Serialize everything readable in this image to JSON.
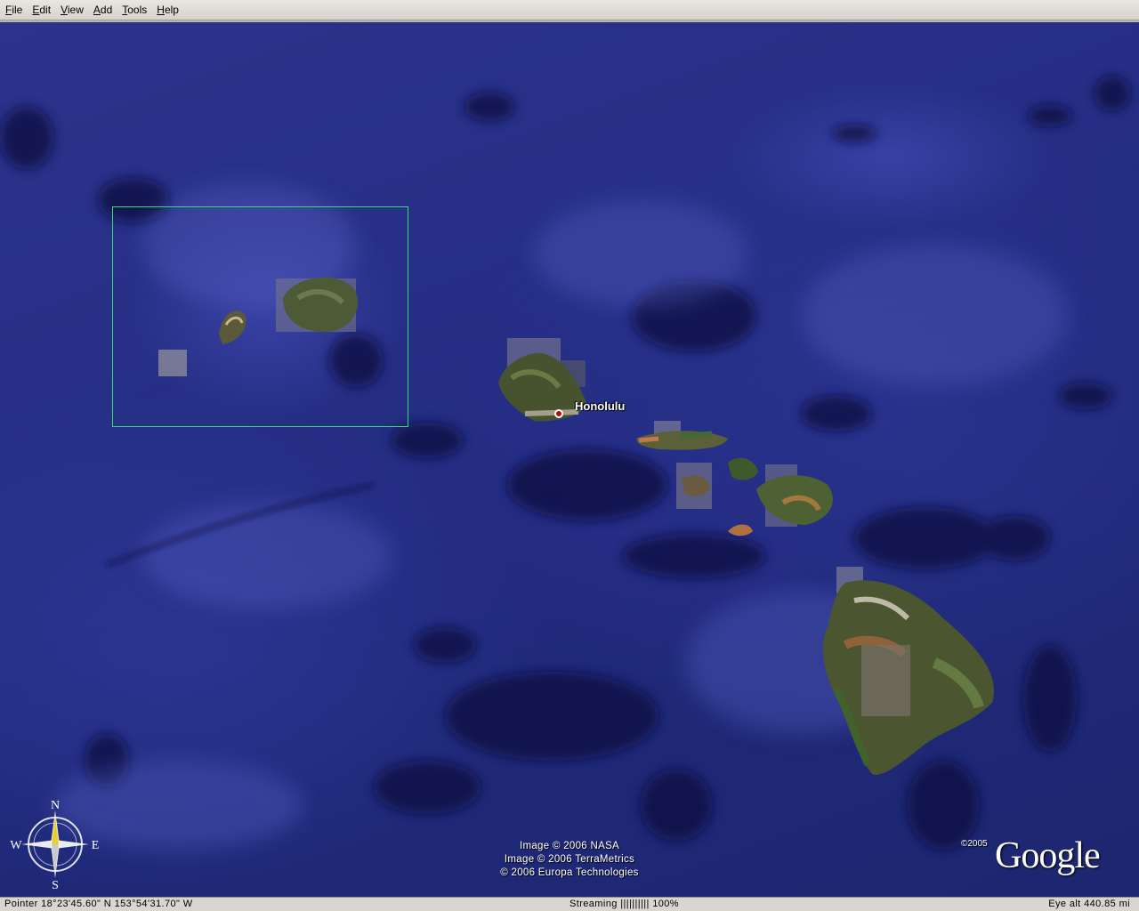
{
  "menu": {
    "items": [
      {
        "mnemonic": "F",
        "rest": "ile"
      },
      {
        "mnemonic": "E",
        "rest": "dit"
      },
      {
        "mnemonic": "V",
        "rest": "iew"
      },
      {
        "mnemonic": "A",
        "rest": "dd"
      },
      {
        "mnemonic": "T",
        "rest": "ools"
      },
      {
        "mnemonic": "H",
        "rest": "elp"
      }
    ]
  },
  "map": {
    "place_label": "Honolulu",
    "credits": [
      "Image © 2006 NASA",
      "Image © 2006 TerraMetrics",
      "© 2006 Europa Technologies"
    ],
    "logo_text": "Google",
    "logo_copyright": "©2005",
    "compass": {
      "n": "N",
      "s": "S",
      "e": "E",
      "w": "W"
    },
    "selection_color": "#2fe06a",
    "ocean_color": "#262f85"
  },
  "status": {
    "pointer": "Pointer  18°23'45.60\" N  153°54'31.70\" W",
    "streaming": "Streaming ||||||||||  100%",
    "eye_alt": "Eye  alt   440.85 mi"
  }
}
